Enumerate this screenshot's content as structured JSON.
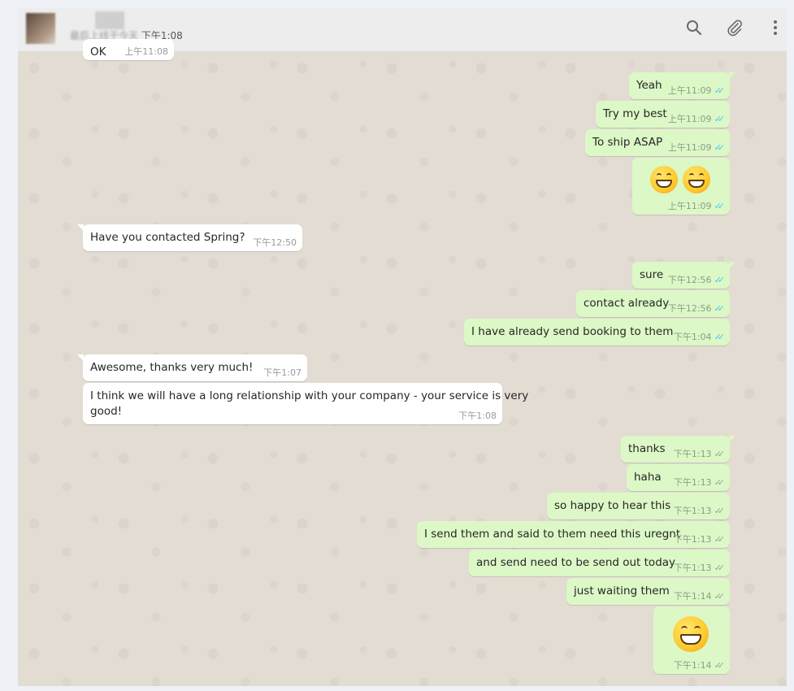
{
  "header": {
    "status_text": "最后上线于今天",
    "status_time": "下午1:08",
    "search_icon": "search-icon",
    "attach_icon": "paperclip-icon",
    "menu_icon": "more-vertical-icon"
  },
  "colors": {
    "outgoing_bubble": "#dcf8c6",
    "incoming_bubble": "#ffffff",
    "read_tick": "#4fc3f7",
    "chat_background": "#e3dcd3"
  },
  "messages": [
    {
      "dir": "in",
      "text": "OK",
      "time": "上午11:08"
    },
    {
      "dir": "out",
      "text": "Yeah",
      "time": "上午11:09",
      "status": "read"
    },
    {
      "dir": "out",
      "text": "Try my best",
      "time": "上午11:09",
      "status": "read"
    },
    {
      "dir": "out",
      "text": "To ship ASAP",
      "time": "上午11:09",
      "status": "read"
    },
    {
      "dir": "out",
      "emoji": "grinning-face-x2",
      "time": "上午11:09",
      "status": "read"
    },
    {
      "dir": "in",
      "text": "Have you contacted Spring?",
      "time": "下午12:50"
    },
    {
      "dir": "out",
      "text": "sure",
      "time": "下午12:56",
      "status": "read"
    },
    {
      "dir": "out",
      "text": "contact already",
      "time": "下午12:56",
      "status": "read"
    },
    {
      "dir": "out",
      "text": "I  have already send booking to them",
      "time": "下午1:04",
      "status": "read"
    },
    {
      "dir": "in",
      "text": "Awesome, thanks very much!",
      "time": "下午1:07"
    },
    {
      "dir": "in",
      "text_line1": "I think we will have a long relationship with your company - your service is very",
      "text_line2": "good!",
      "time": "下午1:08"
    },
    {
      "dir": "out",
      "text": "thanks",
      "time": "下午1:13",
      "status": "delivered"
    },
    {
      "dir": "out",
      "text": "haha",
      "time": "下午1:13",
      "status": "delivered"
    },
    {
      "dir": "out",
      "text": "so happy to hear this",
      "time": "下午1:13",
      "status": "delivered"
    },
    {
      "dir": "out",
      "text": "I send them and said to them need this uregnt",
      "time": "下午1:13",
      "status": "delivered"
    },
    {
      "dir": "out",
      "text": "and send need to be send out today",
      "time": "下午1:13",
      "status": "delivered"
    },
    {
      "dir": "out",
      "text": "just waiting them",
      "time": "下午1:14",
      "status": "delivered"
    },
    {
      "dir": "out",
      "emoji": "grinning-face",
      "time": "下午1:14",
      "status": "delivered"
    }
  ]
}
